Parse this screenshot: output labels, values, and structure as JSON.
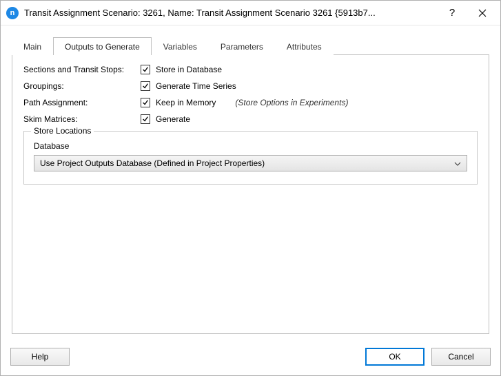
{
  "window": {
    "icon_letter": "n",
    "title": "Transit Assignment Scenario: 3261, Name: Transit Assignment Scenario 3261  {5913b7..."
  },
  "tabs": {
    "items": [
      {
        "label": "Main",
        "active": false
      },
      {
        "label": "Outputs to Generate",
        "active": true
      },
      {
        "label": "Variables",
        "active": false
      },
      {
        "label": "Parameters",
        "active": false
      },
      {
        "label": "Attributes",
        "active": false
      }
    ]
  },
  "panel": {
    "rows": {
      "sections": {
        "label": "Sections and Transit Stops:",
        "checkbox_label": "Store in Database",
        "checked": true
      },
      "groupings": {
        "label": "Groupings:",
        "checkbox_label": "Generate Time Series",
        "checked": true
      },
      "path": {
        "label": "Path Assignment:",
        "checkbox_label": "Keep in Memory",
        "checked": true,
        "hint": "(Store Options in Experiments)"
      },
      "skim": {
        "label": "Skim Matrices:",
        "checkbox_label": "Generate",
        "checked": true
      }
    },
    "store_locations": {
      "legend": "Store Locations",
      "database_label": "Database",
      "database_value": "Use Project Outputs Database (Defined in Project Properties)"
    }
  },
  "footer": {
    "help": "Help",
    "ok": "OK",
    "cancel": "Cancel"
  }
}
